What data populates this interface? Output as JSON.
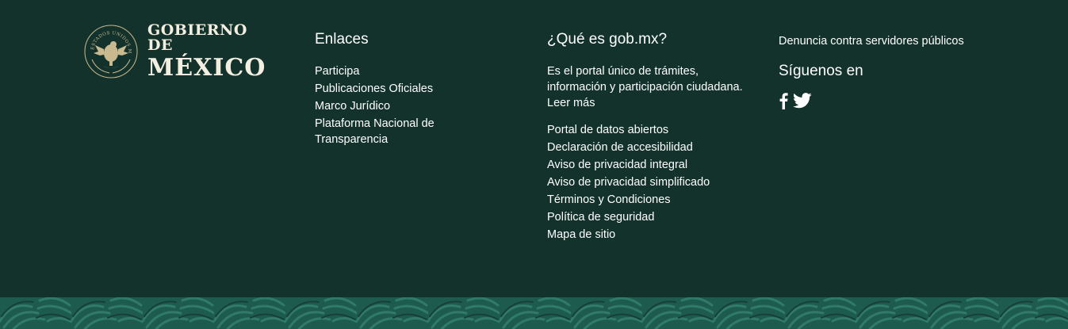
{
  "logo": {
    "line1": "GOBIERNO DE",
    "line2": "MÉXICO",
    "seal_text": "ESTADOS UNIDOS MEXICANOS"
  },
  "enlaces": {
    "title": "Enlaces",
    "items": [
      "Participa",
      "Publicaciones Oficiales",
      "Marco Jurídico",
      "Plataforma Nacional de Transparencia"
    ]
  },
  "gob": {
    "title": "¿Qué es gob.mx?",
    "description": "Es el portal único de trámites, información y participación ciudadana. Leer más",
    "items": [
      "Portal de datos abiertos",
      "Declaración de accesibilidad",
      "Aviso de privacidad integral",
      "Aviso de privacidad simplificado",
      "Términos y Condiciones",
      "Política de seguridad",
      "Mapa de sitio"
    ]
  },
  "right": {
    "denuncia": "Denuncia contra servidores públicos",
    "siguenos": "Síguenos en",
    "social": [
      "facebook-icon",
      "twitter-icon"
    ]
  },
  "colors": {
    "background": "#13322b",
    "pattern": "#1e5b4f",
    "logo_text": "#f3eee0"
  }
}
